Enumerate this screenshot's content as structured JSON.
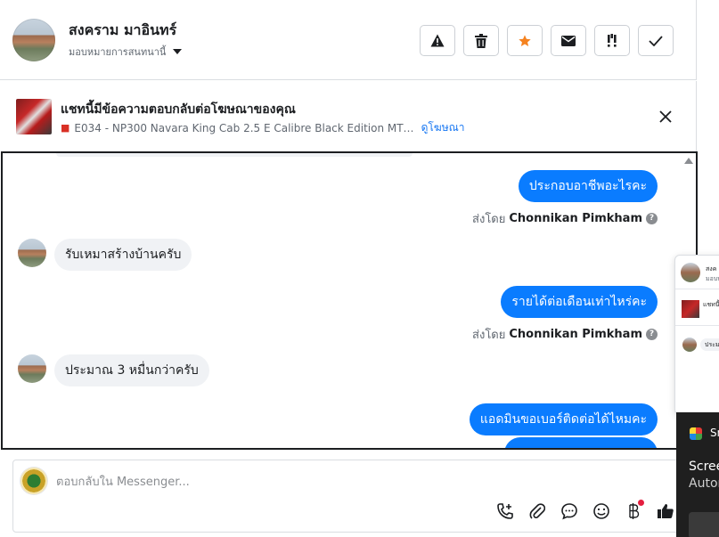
{
  "header": {
    "contact_name": "สงคราม มาอินทร์",
    "assign_label": "มอบหมายการสนทนานี้",
    "toolbar": [
      {
        "name": "report-button",
        "icon": "warning-icon"
      },
      {
        "name": "delete-button",
        "icon": "trash-icon"
      },
      {
        "name": "star-button",
        "icon": "star-icon"
      },
      {
        "name": "mark-unread-button",
        "icon": "envelope-icon"
      },
      {
        "name": "follow-up-button",
        "icon": "exclamation-icon"
      },
      {
        "name": "mark-done-button",
        "icon": "check-icon"
      }
    ]
  },
  "ad_banner": {
    "title": "แชทนี้มีข้อความตอบกลับต่อโฆษณาของคุณ",
    "ad_name": "E034 - NP300 Navara King Cab 2.5 E Calibre Black Edition MT…",
    "view_ad_link": "ดูโฆษณา"
  },
  "messages": [
    {
      "direction": "out",
      "text": "ประกอบอาชีพอะไรคะ",
      "sender_prefix": "ส่งโดย",
      "sender_name": "Chonnikan Pimkham"
    },
    {
      "direction": "in",
      "text": "รับเหมาสร้างบ้านครับ"
    },
    {
      "direction": "out",
      "text": "รายได้ต่อเดือนเท่าไหร่คะ",
      "sender_prefix": "ส่งโดย",
      "sender_name": "Chonnikan Pimkham"
    },
    {
      "direction": "in",
      "text": "ประมาณ 3 หมื่นกว่าครับ"
    },
    {
      "direction": "out",
      "text": "แอดมินขอเบอร์ติดต่อได้ไหมคะ"
    }
  ],
  "composer": {
    "placeholder": "ตอบกลับใน Messenger...",
    "tools": [
      "call-plus-icon",
      "attachment-icon",
      "saved-reply-icon",
      "emoji-icon",
      "payment-icon",
      "like-icon"
    ]
  },
  "mini_preview": {
    "name": "สงค",
    "sub": "มอบห",
    "ad": "แชทนี้",
    "msg": "ประม"
  },
  "toast": {
    "app": "Sn",
    "title": "Scree",
    "body": "Autor"
  },
  "colors": {
    "accent": "#0a7cff",
    "star": "#f5821f",
    "link": "#1877f2"
  }
}
